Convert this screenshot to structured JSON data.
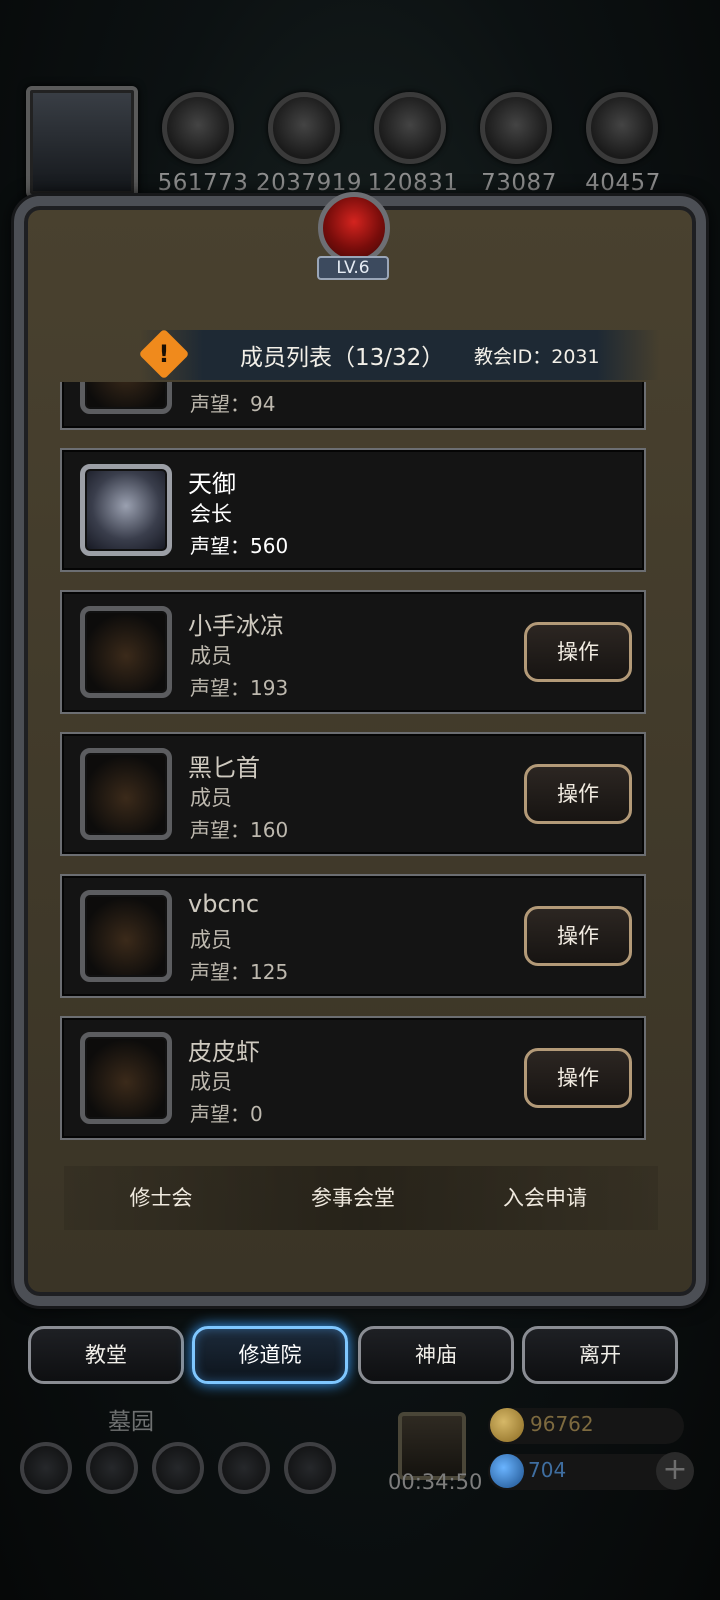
{
  "resources": {
    "values": [
      "561773",
      "2037919",
      "120831",
      "73087",
      "40457"
    ],
    "icons": [
      "meat-icon",
      "wood-icon",
      "stone-icon",
      "crystal-icon",
      "iron-icon"
    ]
  },
  "guild": {
    "level": "LV.6",
    "list_title": "成员列表（13/32）",
    "guild_id": "教会ID：2031",
    "warning_icon": "!"
  },
  "members": [
    {
      "name": "天御",
      "role": "会长",
      "reputation": "声望：560",
      "leader": true
    },
    {
      "name": "小手冰凉",
      "role": "成员",
      "reputation": "声望：193",
      "action": "操作"
    },
    {
      "name": "黑匕首",
      "role": "成员",
      "reputation": "声望：160",
      "action": "操作"
    },
    {
      "name": "vbcnc",
      "role": "成员",
      "reputation": "声望：125",
      "action": "操作"
    },
    {
      "name": "皮皮虾",
      "role": "成员",
      "reputation": "声望：0",
      "action": "操作"
    }
  ],
  "partial_top_card": {
    "reputation": "声望：94"
  },
  "tabs": [
    "修士会",
    "参事会堂",
    "入会申请"
  ],
  "nav": {
    "items": [
      "教堂",
      "修道院",
      "神庙",
      "离开"
    ],
    "active": "修道院"
  },
  "bottom": {
    "cemetery_label": "墓园",
    "timer": "00:34:50",
    "coins": "96762",
    "gems": "704",
    "plus": "+"
  }
}
